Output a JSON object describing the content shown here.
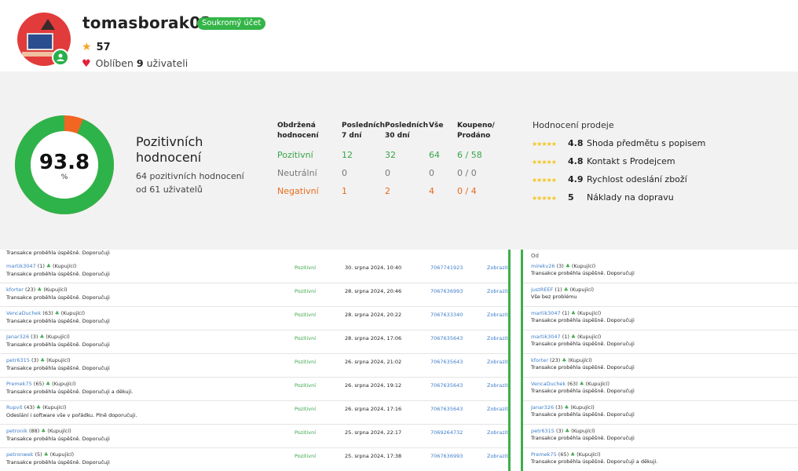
{
  "profile": {
    "username": "tomasborak02",
    "private_badge": "Soukromý účet",
    "rating": "57",
    "liked_prefix": "Oblíben",
    "liked_count": "9",
    "liked_suffix": "uživateli"
  },
  "summary": {
    "percent": "93.8",
    "percent_unit": "%",
    "positive_fraction": 0.938,
    "title": "Pozitivních hodnocení",
    "line1": "64 pozitivních hodnocení",
    "line2": "od 61 uživatelů",
    "colors": {
      "positive": "#2eb34a",
      "negative": "#f26522"
    }
  },
  "feedback_table": {
    "headers": [
      "Obdržená hodnocení",
      "Posledních 7 dní",
      "Posledních 30 dní",
      "Vše",
      "Koupeno/ Prodáno"
    ],
    "rows": [
      {
        "label": "Pozitivní",
        "d7": "12",
        "d30": "32",
        "all": "64",
        "ratio": "6 / 58"
      },
      {
        "label": "Neutrální",
        "d7": "0",
        "d30": "0",
        "all": "0",
        "ratio": "0 / 0"
      },
      {
        "label": "Negativní",
        "d7": "1",
        "d30": "2",
        "all": "4",
        "ratio": "0 / 4"
      }
    ]
  },
  "seller_ratings": {
    "title": "Hodnocení prodeje",
    "stars": "★★★★★",
    "items": [
      {
        "value": "4.8",
        "label": "Shoda předmětu s popisem"
      },
      {
        "value": "4.8",
        "label": "Kontakt s Prodejcem"
      },
      {
        "value": "4.9",
        "label": "Rychlost odeslání zboží"
      },
      {
        "value": "5",
        "label": "Náklady na dopravu"
      }
    ]
  },
  "left_list": {
    "top_comment": "Transakce proběhla úspěšně. Doporučuji",
    "rows": [
      {
        "user": "martik3047",
        "score": "(1)",
        "role": "(Kupující)",
        "comment": "Transakce proběhla úspěšně. Doporučuji",
        "result": "Pozitivní",
        "date": "30. srpna 2024, 10:40",
        "number": "7067741923",
        "action": "Zobrazit"
      },
      {
        "user": "kforter",
        "score": "(23)",
        "role": "(Kupující)",
        "comment": "Transakce proběhla úspěšně. Doporučuji",
        "result": "Pozitivní",
        "date": "28. srpna 2024, 20:46",
        "number": "7067636993",
        "action": "Zobrazit"
      },
      {
        "user": "VencaDuchek",
        "score": "(63)",
        "role": "(Kupující)",
        "comment": "Transakce proběhla úspěšně. Doporučuji",
        "result": "Pozitivní",
        "date": "28. srpna 2024, 20:22",
        "number": "7067633340",
        "action": "Zobrazit"
      },
      {
        "user": "Janar326",
        "score": "(3)",
        "role": "(Kupující)",
        "comment": "Transakce proběhla úspěšně. Doporučuji",
        "result": "Pozitivní",
        "date": "28. srpna 2024, 17:06",
        "number": "7067635643",
        "action": "Zobrazit"
      },
      {
        "user": "petr6315",
        "score": "(3)",
        "role": "(Kupující)",
        "comment": "Transakce proběhla úspěšně. Doporučuji",
        "result": "Pozitivní",
        "date": "26. srpna 2024, 21:02",
        "number": "7067635643",
        "action": "Zobrazit"
      },
      {
        "user": "Premek75",
        "score": "(65)",
        "role": "(Kupující)",
        "comment": "Transakce proběhla úspěšně. Doporučuji a děkuji.",
        "result": "Pozitivní",
        "date": "26. srpna 2024, 19:12",
        "number": "7067635643",
        "action": "Zobrazit"
      },
      {
        "user": "Rupvit",
        "score": "(43)",
        "role": "(Kupující)",
        "comment": "Odeslání i software vše v pořádku. Plně doporučuji.",
        "result": "Pozitivní",
        "date": "26. srpna 2024, 17:16",
        "number": "7067635643",
        "action": "Zobrazit"
      },
      {
        "user": "petronik",
        "score": "(88)",
        "role": "(Kupující)",
        "comment": "Transakce proběhla úspěšně. Doporučuji",
        "result": "Pozitivní",
        "date": "25. srpna 2024, 22:17",
        "number": "7069264732",
        "action": "Zobrazit"
      },
      {
        "user": "petronwek",
        "score": "(5)",
        "role": "(Kupující)",
        "comment": "Transakce proběhla úspěšně. Doporučuji",
        "result": "Pozitivní",
        "date": "25. srpna 2024, 17:38",
        "number": "7067636993",
        "action": "Zobrazit"
      }
    ]
  },
  "right_list": {
    "header": "Od",
    "rows": [
      {
        "user": "mirekv26",
        "score": "(3)",
        "role": "(Kupující)",
        "comment": "Transakce proběhla úspěšně. Doporučuji"
      },
      {
        "user": "justREEF",
        "score": "(1)",
        "role": "(Kupující)",
        "comment": "Vše bez problému"
      },
      {
        "user": "martik3047",
        "score": "(1)",
        "role": "(Kupující)",
        "comment": "Transakce proběhla úspěšně. Doporučuji"
      },
      {
        "user": "martik3047",
        "score": "(1)",
        "role": "(Kupující)",
        "comment": "Transakce proběhla úspěšně. Doporučuji"
      },
      {
        "user": "kforter",
        "score": "(23)",
        "role": "(Kupující)",
        "comment": "Transakce proběhla úspěšně. Doporučuji"
      },
      {
        "user": "VencaDuchek",
        "score": "(63)",
        "role": "(Kupující)",
        "comment": "Transakce proběhla úspěšně. Doporučuji"
      },
      {
        "user": "Janar326",
        "score": "(3)",
        "role": "(Kupující)",
        "comment": "Transakce proběhla úspěšně. Doporučuji"
      },
      {
        "user": "petr6315",
        "score": "(3)",
        "role": "(Kupující)",
        "comment": "Transakce proběhla úspěšně. Doporučuji"
      },
      {
        "user": "Premek75",
        "score": "(65)",
        "role": "(Kupující)",
        "comment": "Transakce proběhla úspěšně. Doporučuji a děkuji."
      }
    ]
  }
}
